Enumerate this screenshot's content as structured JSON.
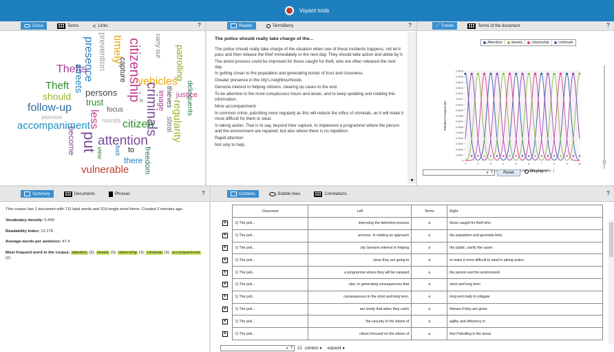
{
  "app_title": "Voyant tools",
  "help_label": "?",
  "top_left": {
    "tabs": [
      {
        "label": "Cirrus",
        "icon": "cloud-icon"
      },
      {
        "label": "Terms",
        "icon": "grid-icon"
      },
      {
        "label": "Links",
        "icon": "links-icon"
      }
    ]
  },
  "cirrus_words": [
    {
      "text": "presence",
      "color": "#2b7bb9"
    },
    {
      "text": "prevention",
      "color": "#999999"
    },
    {
      "text": "timely",
      "color": "#e8a70b"
    },
    {
      "text": "citizenship",
      "color": "#c23b8d"
    },
    {
      "text": "capture",
      "color": "#333333"
    },
    {
      "text": "carry out",
      "color": "#777777"
    },
    {
      "text": "patrolling",
      "color": "#8aa928"
    },
    {
      "text": "Thefts",
      "color": "#a23b8d"
    },
    {
      "text": "streets",
      "color": "#1e7fbf"
    },
    {
      "text": "Theft",
      "color": "#2a8a2a"
    },
    {
      "text": "vehicles",
      "color": "#e8a70b"
    },
    {
      "text": "criminals",
      "color": "#7a4a9a"
    },
    {
      "text": "justice",
      "color": "#c23b8d"
    },
    {
      "text": "should",
      "color": "#9ab728"
    },
    {
      "text": "persons",
      "color": "#444444"
    },
    {
      "text": "image",
      "color": "#a23b8d"
    },
    {
      "text": "thieves",
      "color": "#444444"
    },
    {
      "text": "delinquents",
      "color": "#2a7a4a"
    },
    {
      "text": "follow-up",
      "color": "#2a6aa0"
    },
    {
      "text": "trust",
      "color": "#2a8a2a"
    },
    {
      "text": "regularity",
      "color": "#9ab728"
    },
    {
      "text": "focus",
      "color": "#555555"
    },
    {
      "text": "is",
      "color": "#555555"
    },
    {
      "text": "attentive",
      "color": "#aaaaaa"
    },
    {
      "text": "accompaniment",
      "color": "#1e8fbf"
    },
    {
      "text": "less",
      "color": "#c23b8d"
    },
    {
      "text": "rounds",
      "color": "#aaaaaa"
    },
    {
      "text": "citizen",
      "color": "#2a8a2a"
    },
    {
      "text": "steal",
      "color": "#777777"
    },
    {
      "text": "become",
      "color": "#7a4a9a"
    },
    {
      "text": "put",
      "color": "#7a4a9a"
    },
    {
      "text": "attention",
      "color": "#7a4a9a"
    },
    {
      "text": "view",
      "color": "#2a8a2a"
    },
    {
      "text": "foot",
      "color": "#2a7ab0"
    },
    {
      "text": "to",
      "color": "#222222"
    },
    {
      "text": "there",
      "color": "#1e7fbf"
    },
    {
      "text": "freedom",
      "color": "#2a7a4a"
    },
    {
      "text": "vulnerable",
      "color": "#c0392b"
    }
  ],
  "top_mid": {
    "tabs": [
      {
        "label": "Reader",
        "icon": "document-icon"
      },
      {
        "label": "TermsBerry",
        "icon": "circle-icon"
      }
    ],
    "title": "The police should really take charge of the...",
    "paragraphs": [
      "The police should really take charge of the situation when one of these incidents happens, not let it pass and then release the thief immediately or the next day. They should take action and abide by it.",
      "The arrest process could be improved for those caught for theft, who are often released the next day.",
      "In getting closer to the population and generating bonds of trust and closeness.",
      "Greater presence in the city's neighbourhoods",
      "Genuine interest in helping citizens, clearing up cases to the end.",
      "To be attentive to the most conspicuous hours and areas, and to keep updating and rotating this information.",
      "More accompaniment",
      "In common crime, patrolling more regularly as this will reduce the influx of criminals, as it will make it more difficult for them to steal.",
      "In taking action. That is to say, beyond their capture, to implement a programme where the person and the environment are repaired, but also where there is no repetition.",
      "Rapid attention",
      "Not only to help"
    ]
  },
  "top_right": {
    "tabs": [
      {
        "label": "Trends",
        "icon": "trend-icon"
      },
      {
        "label": "Terms of the document",
        "icon": "grid-icon"
      }
    ],
    "reset_label": "Reset",
    "display_label": "Display",
    "select_label": "?"
  },
  "chart_data": {
    "type": "line",
    "xlabel": "Document segments (The police should be...)",
    "ylabel": "Relative Frequencies",
    "x": [
      1,
      2,
      3,
      4,
      5,
      6,
      7,
      8,
      9,
      10
    ],
    "ylim": [
      0,
      0.0016
    ],
    "yticks": [
      "0.0016",
      "0.0015",
      "0.0014",
      "0.0013",
      "0.0012",
      "0.0011",
      "0.0010",
      "0.0009",
      "0.0008",
      "0.0007",
      "0.0006",
      "0.0005",
      "0.0004",
      "0.0003",
      "0.0002",
      "0.0001",
      "0"
    ],
    "series": [
      {
        "name": "Attention",
        "color": "#2b5fa8",
        "peaks": [
          1,
          3,
          5,
          7,
          9
        ]
      },
      {
        "name": "streets",
        "color": "#7bbf3a",
        "peaks": [
          2,
          4,
          6,
          8,
          10
        ]
      },
      {
        "name": "citizenship",
        "color": "#d63b8d",
        "peaks": [
          2.5,
          4.5,
          6.5,
          8.5
        ]
      },
      {
        "name": "criminals",
        "color": "#7a4ab0",
        "peaks": [
          1.5,
          3.5,
          5.5,
          7.5,
          9.5
        ]
      }
    ],
    "peak_value": 0.00155
  },
  "bottom_left": {
    "tabs": [
      {
        "label": "Summary",
        "icon": "summary-icon"
      },
      {
        "label": "Documents",
        "icon": "grid-icon"
      },
      {
        "label": "Phrases",
        "icon": "phrases-icon"
      }
    ],
    "intro": "This corpus has 1 document with 711 total words and 319 single word forms. Created 2 minutes ago.",
    "density_label": "Vocabulary density:",
    "density_value": "0.449",
    "readability_label": "Readability Index:",
    "readability_value": "12.179",
    "avg_label": "Average words per sentence:",
    "avg_value": "47.4",
    "frequent_label": "Most frequent word in the corpus:",
    "frequent": [
      {
        "word": "attention",
        "count": "(3);"
      },
      {
        "word": "streets",
        "count": "(3);"
      },
      {
        "word": "citizenship",
        "count": "(3);"
      },
      {
        "word": "criminals",
        "count": "(3);"
      },
      {
        "word": "accompaniment",
        "count": "(2)"
      }
    ]
  },
  "bottom_right": {
    "tabs": [
      {
        "label": "Contexts",
        "icon": "contexts-icon"
      },
      {
        "label": "Bubble lines",
        "icon": "eye-icon"
      },
      {
        "label": "Correlations",
        "icon": "grid-icon"
      }
    ],
    "columns": [
      "Document",
      "Left",
      "Terms",
      "Right"
    ],
    "rows": [
      {
        "doc": "1) The poli...",
        "left": "improving the detention process",
        "term": "a",
        "right": "those caught for theft who"
      },
      {
        "doc": "1) The poli...",
        "left": "process. In making an approach",
        "term": "a",
        "right": "the population and generate links"
      },
      {
        "doc": "1) The poli...",
        "left": "city Genuine interest in helping",
        "term": "a",
        "right": "the public, clarify the cases"
      },
      {
        "doc": "1) The poli...",
        "left": "since they are going to",
        "term": "a",
        "right": "to make it more difficult to steal In taking action"
      },
      {
        "doc": "1) The poli...",
        "left": "a programme where they will be repaired",
        "term": "a",
        "right": "the person and the environment"
      },
      {
        "doc": "1) The poli...",
        "left": "also, in generating consequences that",
        "term": "a",
        "right": "short and long term"
      },
      {
        "doc": "1) The poli...",
        "left": "consequences in the short and long term.",
        "term": "a",
        "right": "long term help to mitigate"
      },
      {
        "doc": "1) The poli...",
        "left": "are lonely that when they catch",
        "term": "a",
        "right": "thieves if they are given"
      },
      {
        "doc": "1) The poli...",
        "left": "the security of the citizen of",
        "term": "a",
        "right": "agility and efficiency in"
      },
      {
        "doc": "1) The poli...",
        "left": "citizen focused on the citizen of",
        "term": "a",
        "right": "foot Patrolling in the areas"
      }
    ],
    "footer_select": "?",
    "footer_count": "21",
    "footer_context": "context",
    "footer_expand": "expand"
  }
}
